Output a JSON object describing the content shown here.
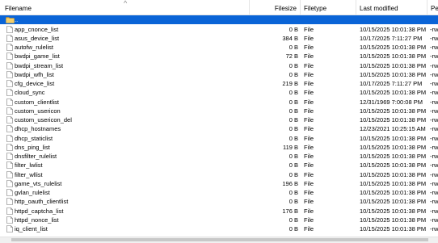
{
  "header": {
    "filename": "Filename",
    "filesize": "Filesize",
    "filetype": "Filetype",
    "last_modified": "Last modified",
    "permissions": "Per"
  },
  "parent_dir": "..",
  "files": [
    {
      "name": "app_cnonce_list",
      "size": "0 B",
      "type": "File",
      "modified": "10/15/2025 10:01:38 PM",
      "perm": "-rw"
    },
    {
      "name": "asus_device_list",
      "size": "384 B",
      "type": "File",
      "modified": "10/17/2025 7:11:27 PM",
      "perm": "-rw"
    },
    {
      "name": "autofw_rulelist",
      "size": "0 B",
      "type": "File",
      "modified": "10/15/2025 10:01:38 PM",
      "perm": "-rw"
    },
    {
      "name": "bwdpi_game_list",
      "size": "72 B",
      "type": "File",
      "modified": "10/15/2025 10:01:38 PM",
      "perm": "-rw"
    },
    {
      "name": "bwdpi_stream_list",
      "size": "0 B",
      "type": "File",
      "modified": "10/15/2025 10:01:38 PM",
      "perm": "-rw"
    },
    {
      "name": "bwdpi_wfh_list",
      "size": "0 B",
      "type": "File",
      "modified": "10/15/2025 10:01:38 PM",
      "perm": "-rw"
    },
    {
      "name": "cfg_device_list",
      "size": "219 B",
      "type": "File",
      "modified": "10/17/2025 7:11:27 PM",
      "perm": "-rw"
    },
    {
      "name": "cloud_sync",
      "size": "0 B",
      "type": "File",
      "modified": "10/15/2025 10:01:38 PM",
      "perm": "-rw"
    },
    {
      "name": "custom_clientlist",
      "size": "0 B",
      "type": "File",
      "modified": "12/31/1969 7:00:08 PM",
      "perm": "-rw"
    },
    {
      "name": "custom_usericon",
      "size": "0 B",
      "type": "File",
      "modified": "10/15/2025 10:01:38 PM",
      "perm": "-rw"
    },
    {
      "name": "custom_usericon_del",
      "size": "0 B",
      "type": "File",
      "modified": "10/15/2025 10:01:38 PM",
      "perm": "-rw"
    },
    {
      "name": "dhcp_hostnames",
      "size": "0 B",
      "type": "File",
      "modified": "12/23/2021 10:25:15 AM",
      "perm": "-rw"
    },
    {
      "name": "dhcp_staticlist",
      "size": "0 B",
      "type": "File",
      "modified": "10/15/2025 10:01:38 PM",
      "perm": "-rw"
    },
    {
      "name": "dns_ping_list",
      "size": "119 B",
      "type": "File",
      "modified": "10/15/2025 10:01:38 PM",
      "perm": "-rw"
    },
    {
      "name": "dnsfilter_rulelist",
      "size": "0 B",
      "type": "File",
      "modified": "10/15/2025 10:01:38 PM",
      "perm": "-rw"
    },
    {
      "name": "filter_lwlist",
      "size": "0 B",
      "type": "File",
      "modified": "10/15/2025 10:01:38 PM",
      "perm": "-rw"
    },
    {
      "name": "filter_wllist",
      "size": "0 B",
      "type": "File",
      "modified": "10/15/2025 10:01:38 PM",
      "perm": "-rw"
    },
    {
      "name": "game_vts_rulelist",
      "size": "196 B",
      "type": "File",
      "modified": "10/15/2025 10:01:38 PM",
      "perm": "-rw"
    },
    {
      "name": "gvlan_rulelist",
      "size": "0 B",
      "type": "File",
      "modified": "10/15/2025 10:01:38 PM",
      "perm": "-rw"
    },
    {
      "name": "http_oauth_clientlist",
      "size": "0 B",
      "type": "File",
      "modified": "10/15/2025 10:01:38 PM",
      "perm": "-rw"
    },
    {
      "name": "httpd_captcha_list",
      "size": "176 B",
      "type": "File",
      "modified": "10/15/2025 10:01:38 PM",
      "perm": "-rw"
    },
    {
      "name": "httpd_nonce_list",
      "size": "0 B",
      "type": "File",
      "modified": "10/15/2025 10:01:38 PM",
      "perm": "-rw"
    },
    {
      "name": "iq_client_list",
      "size": "0 B",
      "type": "File",
      "modified": "10/15/2025 10:01:38 PM",
      "perm": "-rw"
    }
  ],
  "icons": {
    "file": "file-icon",
    "folder": "folder-icon"
  },
  "colors": {
    "selection": "#0a64d7",
    "folder": "#e8b64c"
  }
}
